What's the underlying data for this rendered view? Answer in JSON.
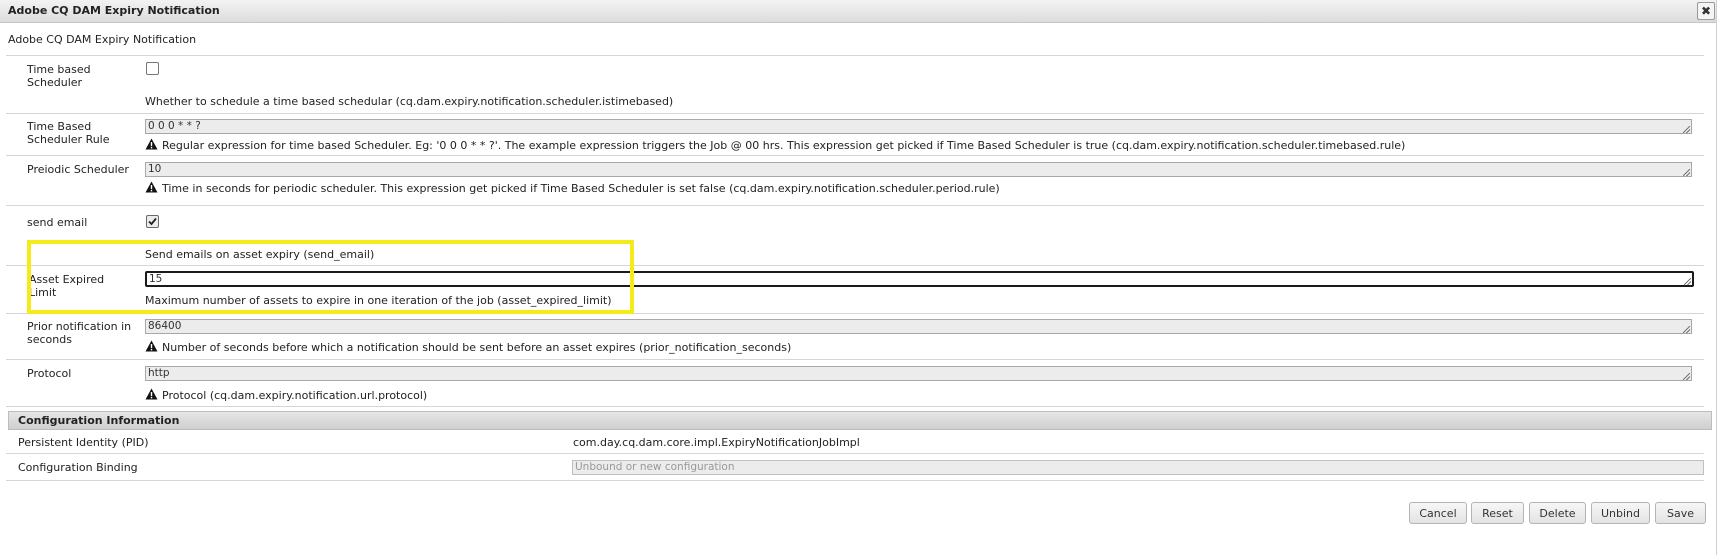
{
  "dialog": {
    "title": "Adobe CQ DAM Expiry Notification",
    "subtitle": "Adobe CQ DAM Expiry Notification",
    "close_glyph": "✖"
  },
  "fields": {
    "time_based_scheduler": {
      "label": "Time based Scheduler",
      "checked": false,
      "description": "Whether to schedule a time based schedular (cq.dam.expiry.notification.scheduler.istimebased)"
    },
    "time_based_rule": {
      "label": "Time Based Scheduler Rule",
      "value": "0 0 0 * * ?",
      "description": "Regular expression for time based Scheduler. Eg: '0 0 0 * * ?'. The example expression triggers the Job @ 00 hrs. This expression get picked if Time Based Scheduler is true (cq.dam.expiry.notification.scheduler.timebased.rule)"
    },
    "periodic_scheduler": {
      "label": "Preiodic Scheduler",
      "value": "10",
      "description": "Time in seconds for periodic scheduler. This expression get picked if Time Based Scheduler is set false (cq.dam.expiry.notification.scheduler.period.rule)"
    },
    "send_email": {
      "label": "send email",
      "checked": true,
      "description": "Send emails on asset expiry (send_email)"
    },
    "asset_expired_limit": {
      "label": "Asset Expired Limit",
      "value": "15",
      "description": "Maximum number of assets to expire in one iteration of the job (asset_expired_limit)"
    },
    "prior_notification": {
      "label": "Prior notification in seconds",
      "value": "86400",
      "description": "Number of seconds before which a notification should be sent before an asset expires (prior_notification_seconds)"
    },
    "protocol": {
      "label": "Protocol",
      "value": "http",
      "description": "Protocol (cq.dam.expiry.notification.url.protocol)"
    }
  },
  "config_info": {
    "header": "Configuration Information",
    "pid_label": "Persistent Identity (PID)",
    "pid_value": "com.day.cq.dam.core.impl.ExpiryNotificationJobImpl",
    "binding_label": "Configuration Binding",
    "binding_placeholder": "Unbound or new configuration"
  },
  "buttons": {
    "cancel": "Cancel",
    "reset": "Reset",
    "delete": "Delete",
    "unbind": "Unbind",
    "save": "Save"
  },
  "colors": {
    "highlight": "#f5eb1b"
  },
  "icons": {
    "warning": "warning-icon",
    "close": "close-icon",
    "checkmark": "checkmark-icon"
  }
}
